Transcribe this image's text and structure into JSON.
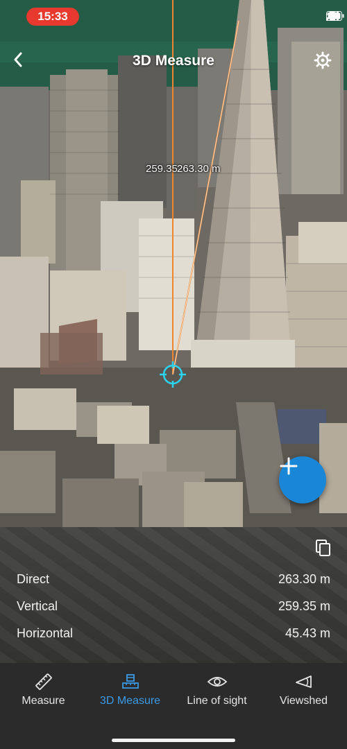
{
  "status_bar": {
    "time": "15:33"
  },
  "nav": {
    "title": "3D Measure"
  },
  "scene": {
    "measure_label_vertical": "259.35",
    "measure_label_direct": "263.30 m"
  },
  "results": {
    "rows": [
      {
        "label": "Direct",
        "value": "263.30 m"
      },
      {
        "label": "Vertical",
        "value": "259.35 m"
      },
      {
        "label": "Horizontal",
        "value": "45.43 m"
      }
    ]
  },
  "tabs": [
    {
      "label": "Measure",
      "icon": "ruler-icon",
      "active": false
    },
    {
      "label": "3D Measure",
      "icon": "3d-measure-icon",
      "active": true
    },
    {
      "label": "Line of sight",
      "icon": "eye-icon",
      "active": false
    },
    {
      "label": "Viewshed",
      "icon": "viewshed-icon",
      "active": false
    }
  ],
  "colors": {
    "accent": "#3b9ae6",
    "fab": "#1a86d8",
    "status_pill": "#e8392e",
    "measure_line": "#f0852d"
  }
}
